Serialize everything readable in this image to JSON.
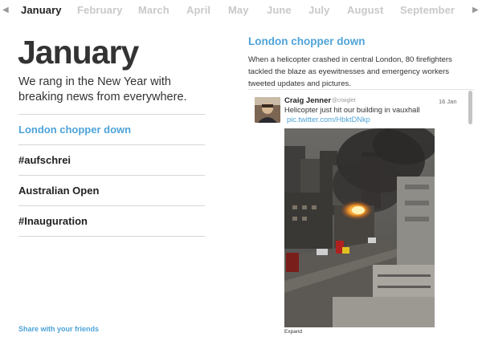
{
  "nav": {
    "months": [
      {
        "label": "January",
        "active": true
      },
      {
        "label": "February",
        "active": false
      },
      {
        "label": "March",
        "active": false
      },
      {
        "label": "April",
        "active": false
      },
      {
        "label": "May",
        "active": false
      },
      {
        "label": "June",
        "active": false
      },
      {
        "label": "July",
        "active": false
      },
      {
        "label": "August",
        "active": false
      },
      {
        "label": "September",
        "active": false
      }
    ],
    "prev_icon": "chevron-left-icon",
    "next_icon": "chevron-right-icon"
  },
  "main": {
    "title": "January",
    "intro": "We rang in the New Year with breaking news from everywhere.",
    "topics": [
      {
        "label": "London chopper down",
        "active": true
      },
      {
        "label": "#aufschrei",
        "active": false
      },
      {
        "label": "Australian Open",
        "active": false
      },
      {
        "label": "#Inauguration",
        "active": false
      }
    ],
    "share_label": "Share with your friends"
  },
  "story": {
    "title": "London chopper down",
    "description": "When a helicopter crashed in central London, 80 firefighters tackled the blaze as eyewitnesses and emergency workers tweeted updates and pictures."
  },
  "tweet": {
    "author_name": "Craig Jenner",
    "author_handle": "@craiglet",
    "date": "16 Jan",
    "text": "Helicopter just hit our building in vauxhall",
    "link": "pic.twitter.com/HbktDNkp",
    "expand_label": "Expand"
  },
  "colors": {
    "accent": "#4ea3d8",
    "inactive_month": "#c9c9c9",
    "text": "#222222",
    "divider": "#d6d6d6"
  }
}
